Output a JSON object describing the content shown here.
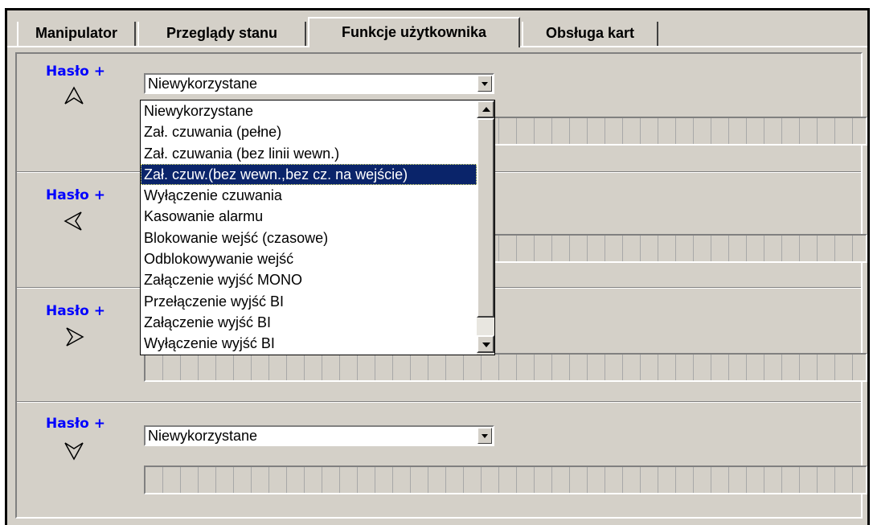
{
  "tabs": [
    {
      "label": "Manipulator",
      "active": false
    },
    {
      "label": "Przeglądy stanu",
      "active": false
    },
    {
      "label": "Funkcje użytkownika",
      "active": true
    },
    {
      "label": "Obsługa kart",
      "active": false
    }
  ],
  "sections": [
    {
      "label": "Hasło +",
      "arrow": "up-arrow-icon",
      "combo_value": "Niewykorzystane"
    },
    {
      "label": "Hasło +",
      "arrow": "left-arrow-icon",
      "combo_value": ""
    },
    {
      "label": "Hasło +",
      "arrow": "right-arrow-icon",
      "combo_value": ""
    },
    {
      "label": "Hasło +",
      "arrow": "down-arrow-icon",
      "combo_value": "Niewykorzystane"
    }
  ],
  "dropdown": {
    "options": [
      "Niewykorzystane",
      "Zał. czuwania (pełne)",
      "Zał. czuwania (bez linii wewn.)",
      "Zał. czuw.(bez wewn.,bez cz. na wejście)",
      "Wyłączenie czuwania",
      "Kasowanie alarmu",
      "Blokowanie wejść (czasowe)",
      "Odblokowywanie wejść",
      "Załączenie wyjść MONO",
      "Przełączenie wyjść BI",
      "Załączenie wyjść BI",
      "Wyłączenie wyjść BI"
    ],
    "selected_index": 3
  },
  "colors": {
    "label_blue": "#0000ff",
    "selection_bg": "#0a246a",
    "window_bg": "#d4d0c8"
  }
}
